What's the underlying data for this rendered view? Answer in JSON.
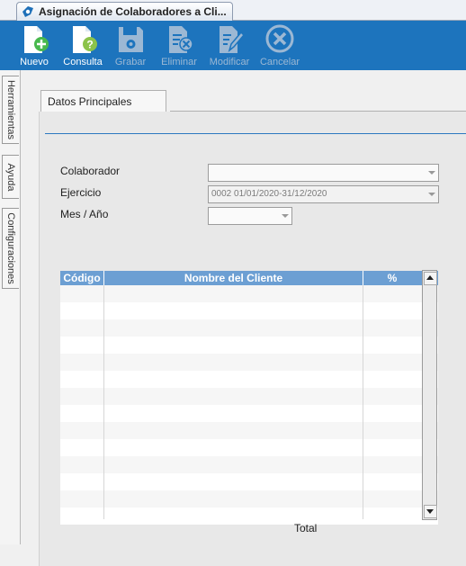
{
  "window_tab": {
    "title": "Asignación de Colaboradores a Cli..."
  },
  "toolbar": {
    "buttons": [
      {
        "label": "Nuevo",
        "icon": "new-document-icon",
        "enabled": true
      },
      {
        "label": "Consulta",
        "icon": "query-document-icon",
        "enabled": true
      },
      {
        "label": "Grabar",
        "icon": "save-disk-icon",
        "enabled": false
      },
      {
        "label": "Eliminar",
        "icon": "delete-document-icon",
        "enabled": false
      },
      {
        "label": "Modificar",
        "icon": "edit-document-icon",
        "enabled": false
      },
      {
        "label": "Cancelar",
        "icon": "cancel-circle-icon",
        "enabled": false
      }
    ]
  },
  "sidebar": {
    "tabs": [
      {
        "label": "Herramientas"
      },
      {
        "label": "Ayuda"
      },
      {
        "label": "Configuraciones"
      }
    ]
  },
  "form": {
    "tab": "Datos Principales",
    "fields": {
      "colaborador": {
        "label": "Colaborador",
        "value": ""
      },
      "ejercicio": {
        "label": "Ejercicio",
        "value": "0002 01/01/2020-31/12/2020"
      },
      "mes_anio": {
        "label": "Mes / Año",
        "value": ""
      }
    }
  },
  "grid": {
    "columns": [
      "Código",
      "Nombre del Cliente",
      "%"
    ],
    "rows": [],
    "total_label": "Total"
  },
  "colors": {
    "toolbar_bg": "#1d74bd",
    "grid_header": "#6c9fd3",
    "accent_line": "#2c78c0"
  }
}
